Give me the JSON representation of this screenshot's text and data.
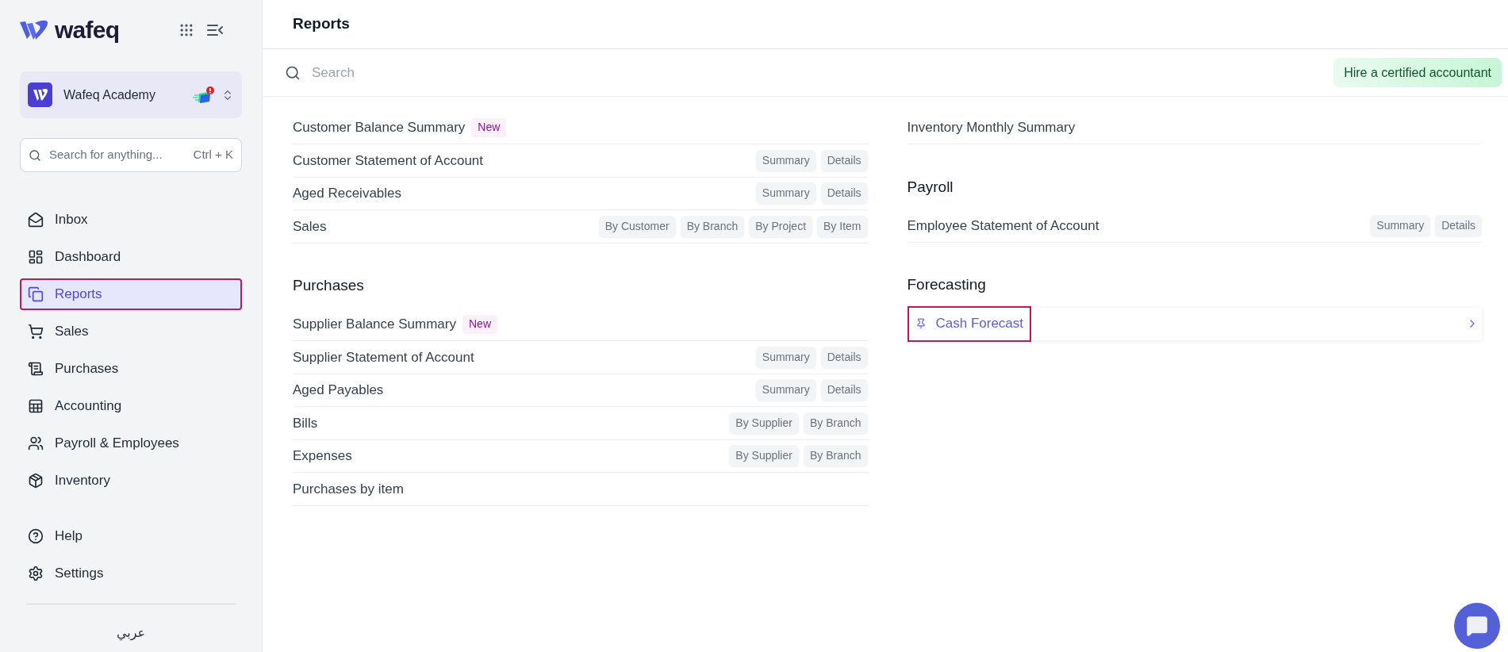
{
  "app": {
    "logo": "wafeq"
  },
  "org": {
    "name": "Wafeq Academy"
  },
  "sidebar_search": {
    "placeholder": "Search for anything...",
    "shortcut": "Ctrl + K"
  },
  "nav": [
    {
      "label": "Inbox",
      "selected": false
    },
    {
      "label": "Dashboard",
      "selected": false
    },
    {
      "label": "Reports",
      "selected": true
    },
    {
      "label": "Sales",
      "selected": false
    },
    {
      "label": "Purchases",
      "selected": false
    },
    {
      "label": "Accounting",
      "selected": false
    },
    {
      "label": "Payroll & Employees",
      "selected": false
    },
    {
      "label": "Inventory",
      "selected": false
    }
  ],
  "nav_secondary": [
    {
      "label": "Help"
    },
    {
      "label": "Settings"
    }
  ],
  "language": "عربي",
  "header": {
    "title": "Reports"
  },
  "search": {
    "placeholder": "Search"
  },
  "cta": "Hire a certified accountant",
  "columns": [
    {
      "sections": [
        {
          "rows": [
            {
              "kind": "report",
              "label": "Customer Balance Summary",
              "badge": "New",
              "tags": []
            },
            {
              "kind": "report",
              "label": "Customer Statement of Account",
              "tags": [
                "Summary",
                "Details"
              ]
            },
            {
              "kind": "report",
              "label": "Aged Receivables",
              "tags": [
                "Summary",
                "Details"
              ]
            },
            {
              "kind": "report",
              "label": "Sales",
              "tags": [
                "By Customer",
                "By Branch",
                "By Project",
                "By Item"
              ]
            }
          ]
        },
        {
          "title": "Purchases",
          "rows": [
            {
              "kind": "report",
              "label": "Supplier Balance Summary",
              "badge": "New",
              "tags": []
            },
            {
              "kind": "report",
              "label": "Supplier Statement of Account",
              "tags": [
                "Summary",
                "Details"
              ]
            },
            {
              "kind": "report",
              "label": "Aged Payables",
              "tags": [
                "Summary",
                "Details"
              ]
            },
            {
              "kind": "report",
              "label": "Bills",
              "tags": [
                "By Supplier",
                "By Branch"
              ]
            },
            {
              "kind": "report",
              "label": "Expenses",
              "tags": [
                "By Supplier",
                "By Branch"
              ]
            },
            {
              "kind": "report",
              "label": "Purchases by item",
              "tags": []
            }
          ]
        }
      ]
    },
    {
      "sections": [
        {
          "rows": [
            {
              "kind": "report",
              "label": "Inventory Monthly Summary",
              "tags": []
            }
          ]
        },
        {
          "title": "Payroll",
          "rows": [
            {
              "kind": "report",
              "label": "Employee Statement of Account",
              "tags": [
                "Summary",
                "Details"
              ]
            }
          ]
        },
        {
          "title": "Forecasting",
          "rows": [
            {
              "kind": "pinned",
              "label": "Cash Forecast",
              "tags": []
            }
          ]
        }
      ]
    }
  ]
}
